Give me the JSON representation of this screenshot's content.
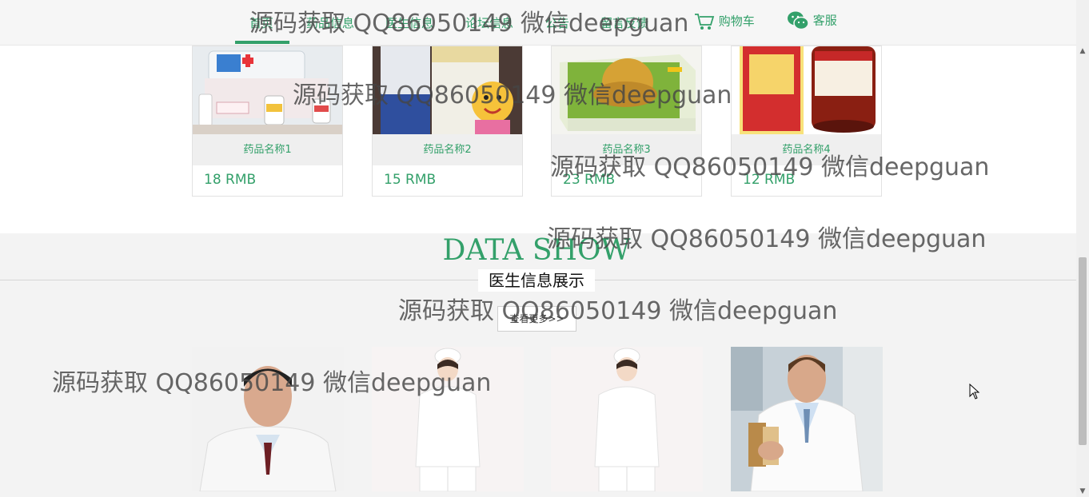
{
  "nav": {
    "items": [
      "首页",
      "药品信息",
      "医生信息",
      "论坛信息",
      "公告",
      "留言反馈"
    ],
    "cart_label": "购物车",
    "service_label": "客服"
  },
  "products": [
    {
      "name": "药品名称1",
      "price": "18 RMB"
    },
    {
      "name": "药品名称2",
      "price": "15 RMB"
    },
    {
      "name": "药品名称3",
      "price": "23 RMB"
    },
    {
      "name": "药品名称4",
      "price": "12 RMB"
    }
  ],
  "data_show": {
    "title": "DATA SHOW",
    "subtitle": "医生信息展示",
    "more_label": "查看更多>>"
  },
  "watermark": "源码获取 QQ86050149 微信deepguan",
  "colors": {
    "accent": "#33a06a"
  }
}
